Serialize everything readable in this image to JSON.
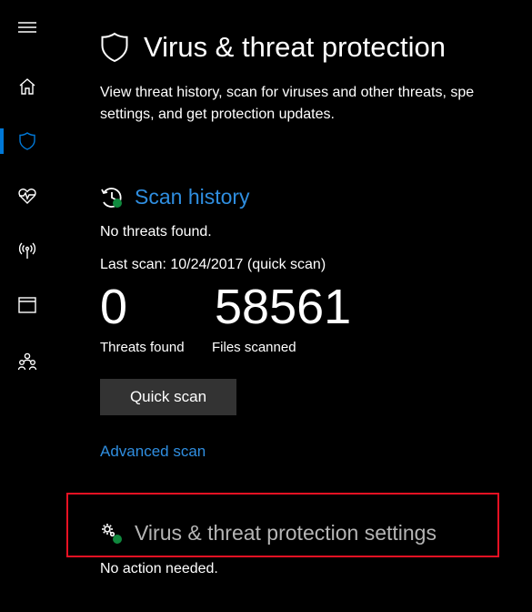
{
  "colors": {
    "background": "#000000",
    "accent": "#0078d7",
    "link": "#2f8ee0",
    "text": "#ffffff",
    "muted": "#b5b5b5",
    "button_bg": "#333333",
    "success_green": "#10893e",
    "highlight_red": "#e81123"
  },
  "sidebar": {
    "items": [
      {
        "name": "hamburger-menu",
        "icon": "hamburger-icon"
      },
      {
        "name": "home",
        "icon": "home-icon"
      },
      {
        "name": "virus-threat-protection",
        "icon": "shield-icon",
        "active": true
      },
      {
        "name": "device-performance-health",
        "icon": "heart-pulse-icon"
      },
      {
        "name": "firewall-network",
        "icon": "antenna-icon"
      },
      {
        "name": "app-browser-control",
        "icon": "browser-window-icon"
      },
      {
        "name": "family-options",
        "icon": "family-icon"
      }
    ]
  },
  "header": {
    "title": "Virus & threat protection",
    "description_line1": "View threat history, scan for viruses and other threats, spe",
    "description_line2": "settings, and get protection updates."
  },
  "scan_history": {
    "title": "Scan history",
    "status": "No threats found.",
    "last_scan": "Last scan: 10/24/2017 (quick scan)",
    "threats_found_value": "0",
    "threats_found_label": "Threats found",
    "files_scanned_value": "58561",
    "files_scanned_label": "Files scanned",
    "quick_scan_label": "Quick scan",
    "advanced_scan_label": "Advanced scan"
  },
  "protection_settings": {
    "title": "Virus & threat protection settings",
    "status": "No action needed."
  }
}
